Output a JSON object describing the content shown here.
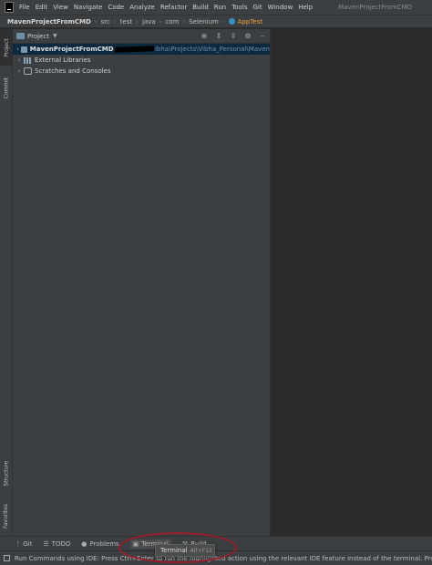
{
  "menubar": {
    "items": [
      "File",
      "Edit",
      "View",
      "Navigate",
      "Code",
      "Analyze",
      "Refactor",
      "Build",
      "Run",
      "Tools",
      "Git",
      "Window",
      "Help"
    ],
    "window_title": "MavenProjectFromCMD"
  },
  "breadcrumb": {
    "items": [
      "MavenProjectFromCMD",
      "src",
      "test",
      "java",
      "com",
      "Selenium",
      "AppTest"
    ]
  },
  "left_strip": {
    "project": "Project",
    "commit": "Commit",
    "structure": "Structure",
    "favorites": "Favorites"
  },
  "project_panel": {
    "title": "Project",
    "tree": {
      "root_label": "MavenProjectFromCMD",
      "root_path": "ibha\\Projects\\Vibha_Personal\\Maven",
      "external_libraries": "External Libraries",
      "scratches": "Scratches and Consoles"
    },
    "icons": [
      "crosshair-icon",
      "collapse-all-icon",
      "expand-all-icon",
      "gear-icon",
      "hide-icon"
    ]
  },
  "bottom_bar": {
    "tabs": [
      "Git",
      "TODO",
      "Problems",
      "Terminal",
      "Build"
    ]
  },
  "status_bar": {
    "text": "Run Commands using IDE: Press Ctrl+Enter to run the highlighted action using the relevant IDE feature instead of the terminal. Press Ctrl+Shift+Enter"
  },
  "tooltip": {
    "label": "Terminal",
    "shortcut": "Alt+F12"
  },
  "colors": {
    "background": "#2b2b2b",
    "panel": "#3c3f41",
    "selection": "#0d293e",
    "accent_file": "#e8a03a",
    "annotation": "#9b1c2a"
  }
}
